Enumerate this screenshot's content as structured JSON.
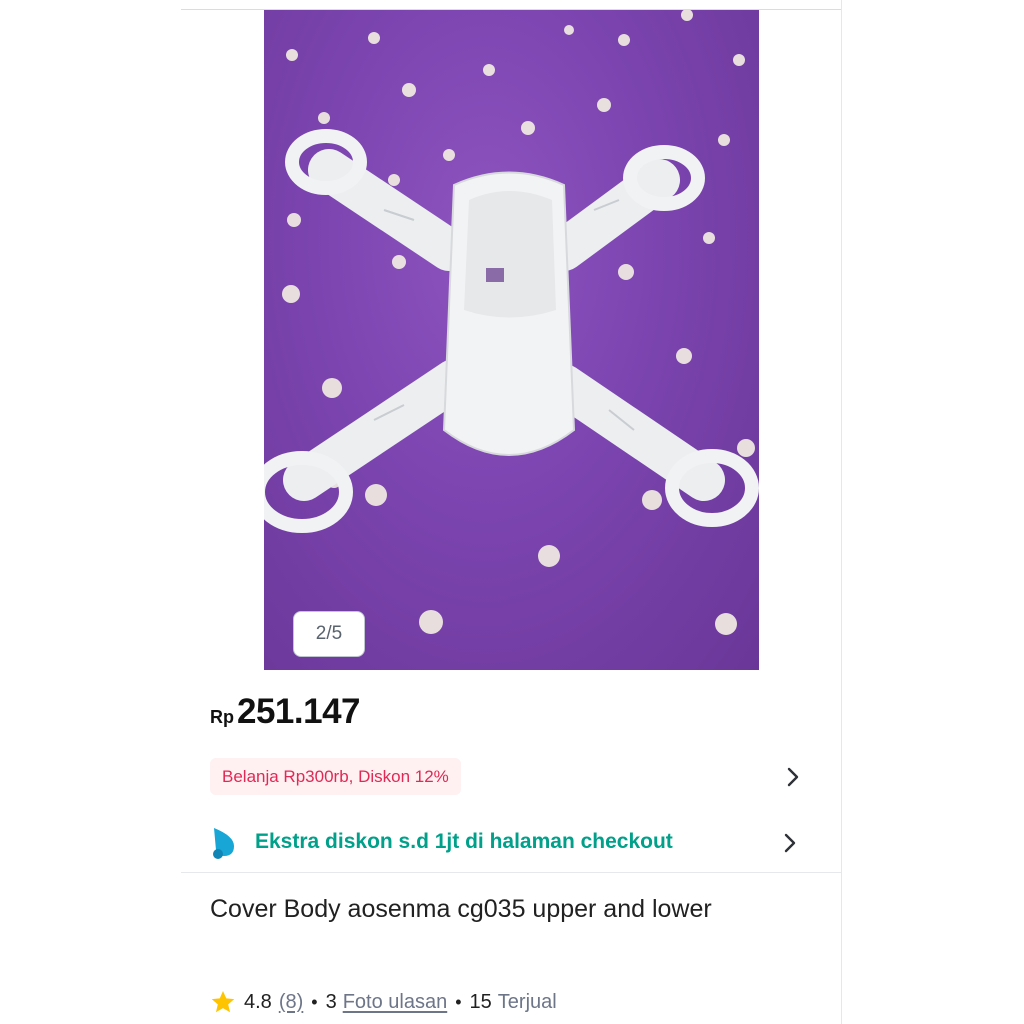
{
  "gallery": {
    "counter": "2/5",
    "image_subject": "white drone body frame on purple polka-dot fabric"
  },
  "price": {
    "currency": "Rp",
    "amount": "251.147"
  },
  "promo": {
    "label": "Belanja Rp300rb, Diskon 12%"
  },
  "extra_discount": {
    "label": "Ekstra diskon s.d 1jt di halaman checkout"
  },
  "product": {
    "title": "Cover Body aosenma cg035 upper and lower",
    "rating": "4.8",
    "rating_count": "(8)",
    "photo_review_count": "3",
    "photo_review_label": "Foto ulasan",
    "sold_count": "15",
    "sold_label": "Terjual"
  },
  "colors": {
    "price_text": "#111111",
    "promo_text": "#e02954",
    "promo_bg": "#fff0f2",
    "extra_text": "#00a08a",
    "star": "#ffc400",
    "photo_bg": "#7b44af"
  },
  "icons": [
    "chevron-right-icon",
    "chevron-right-icon",
    "star-icon",
    "discount-drop-icon"
  ]
}
